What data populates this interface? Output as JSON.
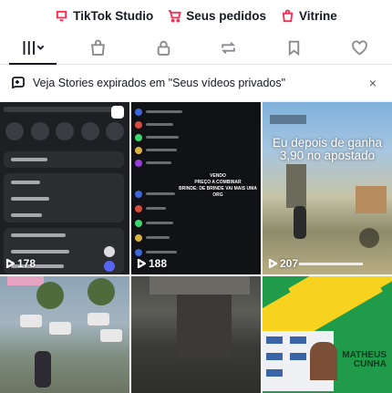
{
  "top_links": [
    {
      "label": "TikTok Studio",
      "icon": "tiktok-studio-icon"
    },
    {
      "label": "Seus pedidos",
      "icon": "cart-icon"
    },
    {
      "label": "Vitrine",
      "icon": "shopping-bag-icon"
    }
  ],
  "tabs": [
    {
      "name": "videos-grid",
      "icon": "grid-icon",
      "active": true
    },
    {
      "name": "shop",
      "icon": "bag-icon"
    },
    {
      "name": "private",
      "icon": "lock-icon"
    },
    {
      "name": "reposts",
      "icon": "repost-icon"
    },
    {
      "name": "favorites",
      "icon": "bookmark-icon"
    },
    {
      "name": "liked",
      "icon": "heart-icon"
    }
  ],
  "notice": {
    "text": "Veja Stories expirados em \"Seus vídeos privados\"",
    "close": "×"
  },
  "videos": [
    {
      "views": "178"
    },
    {
      "views": "188",
      "caption_lines": [
        "VENDO",
        "PREÇO A COMBINAR",
        "BRINDE: DE BRINDE VAI MAIS UMA ORG"
      ]
    },
    {
      "views": "207",
      "caption_lines": [
        "Eu depois de ganha",
        "3,90 no apostado"
      ]
    },
    {
      "views": ""
    },
    {
      "views": ""
    },
    {
      "views": "",
      "name_lines": [
        "MATHEUS",
        "CUNHA"
      ]
    }
  ],
  "colors": {
    "accent": "#fe2c55",
    "text": "#161823",
    "muted": "#8a8b91"
  }
}
